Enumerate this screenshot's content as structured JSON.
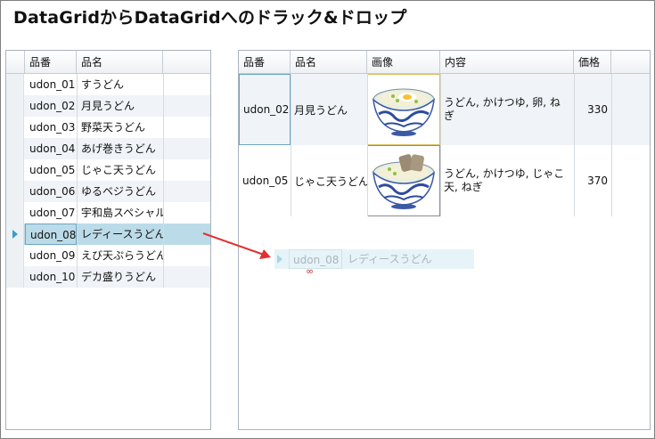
{
  "title": "DataGridからDataGridへのドラック&ドロップ",
  "left_grid": {
    "columns": [
      "品番",
      "品名"
    ],
    "rows": [
      {
        "id": "udon_01",
        "name": "すうどん"
      },
      {
        "id": "udon_02",
        "name": "月見うどん"
      },
      {
        "id": "udon_03",
        "name": "野菜天うどん"
      },
      {
        "id": "udon_04",
        "name": "あげ巻きうどん"
      },
      {
        "id": "udon_05",
        "name": "じゃこ天うどん"
      },
      {
        "id": "udon_06",
        "name": "ゆるベジうどん"
      },
      {
        "id": "udon_07",
        "name": "宇和島スペシャル"
      },
      {
        "id": "udon_08",
        "name": "レディースうどん"
      },
      {
        "id": "udon_09",
        "name": "えび天ぷらうどん"
      },
      {
        "id": "udon_10",
        "name": "デカ盛りうどん"
      }
    ],
    "selected_index": 7
  },
  "right_grid": {
    "columns": [
      "品番",
      "品名",
      "画像",
      "内容",
      "価格"
    ],
    "rows": [
      {
        "id": "udon_02",
        "name": "月見うどん",
        "image_icon": "udon-bowl-egg-icon",
        "content": "うどん, かけつゆ, 卵, ねぎ",
        "price": "330"
      },
      {
        "id": "udon_05",
        "name": "じゃこ天うどん",
        "image_icon": "udon-bowl-jakoten-icon",
        "content": "うどん, かけつゆ, じゃこ天, ねぎ",
        "price": "370"
      }
    ]
  },
  "drag_ghost": {
    "id": "udon_08",
    "name": "レディースうどん"
  },
  "drop_cursor_glyph": "∞",
  "colors": {
    "selection": "#bcdbe8",
    "alt_row": "#f0f3f7",
    "arrow": "#e03030",
    "focus_border": "#6aa6c0"
  }
}
